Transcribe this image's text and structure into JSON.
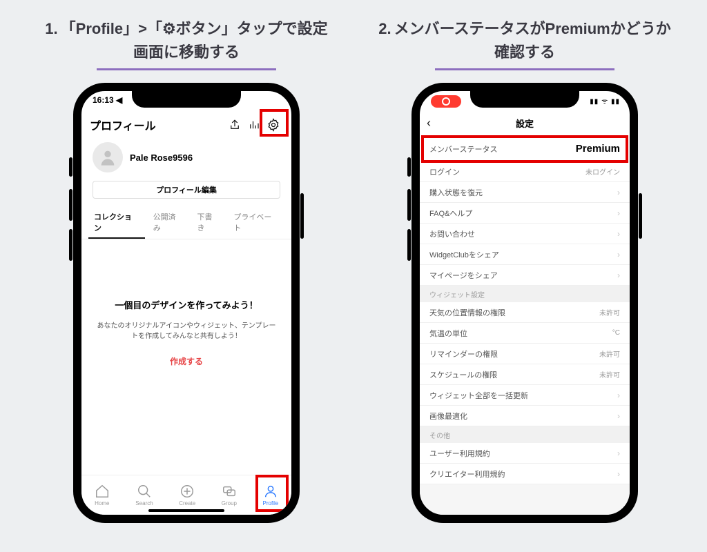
{
  "steps": {
    "s1_num": "1.",
    "s1_text": "「Profile」>「⚙︎ボタン」タップで設定画面に移動する",
    "s2_num": "2.",
    "s2_text": "メンバーステータスがPremiumかどうか確認する"
  },
  "phone1": {
    "time": "16:13 ◀",
    "title": "プロフィール",
    "username": "Pale Rose9596",
    "edit": "プロフィール編集",
    "tabs": [
      "コレクション",
      "公開済み",
      "下書き",
      "プライベート"
    ],
    "body_h": "一個目のデザインを作ってみよう！",
    "body_s": "あなたのオリジナルアイコンやウィジェット、テンプレートを作成してみんなと共有しよう！",
    "create": "作成する",
    "tabbar": {
      "home": "Home",
      "search": "Search",
      "create": "Create",
      "group": "Group",
      "profile": "Profile"
    }
  },
  "phone2": {
    "title": "設定",
    "rows": {
      "member_status": "メンバーステータス",
      "member_value": "Premium",
      "login": "ログイン",
      "login_value": "未ログイン",
      "restore": "購入状態を復元",
      "faq": "FAQ&ヘルプ",
      "contact": "お問い合わせ",
      "share_wc": "WidgetClubをシェア",
      "share_mypage": "マイページをシェア",
      "sec_widget": "ウィジェット設定",
      "weather_loc": "天気の位置情報の権限",
      "not_allowed": "未許可",
      "temp_unit": "気温の単位",
      "temp_val": "°C",
      "reminder": "リマインダーの権限",
      "schedule": "スケジュールの権限",
      "refresh_all": "ウィジェット全部を一括更新",
      "image_opt": "画像最適化",
      "sec_other": "その他",
      "user_terms": "ユーザー利用規約",
      "creator_terms": "クリエイター利用規約"
    },
    "status_right": "▮▮ ᯤ ▮▮"
  }
}
